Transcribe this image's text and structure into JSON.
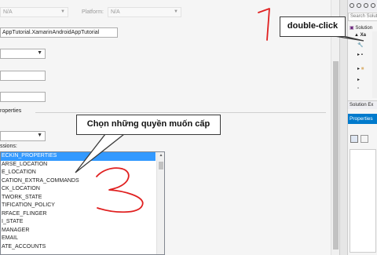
{
  "top_row": {
    "config_value": "N/A",
    "platform_label": "Platform:",
    "platform_value": "N/A"
  },
  "app": {
    "package_name": "AppTutorial.XamarinAndroidAppTutorial"
  },
  "section": {
    "properties_label": "roperties"
  },
  "permissions": {
    "label": "ssions:",
    "items": [
      "ECKIN_PROPERTIES",
      "ARSE_LOCATION",
      "E_LOCATION",
      "CATION_EXTRA_COMMANDS",
      "CK_LOCATION",
      "TWORK_STATE",
      "TIFICATION_POLICY",
      "RFACE_FLINGER",
      "I_STATE",
      "MANAGER",
      "EMAIL",
      "ATE_ACCOUNTS"
    ],
    "selected_index": 0
  },
  "annotations": {
    "callout_main": "Chọn những quyền muốn cấp",
    "callout_dbl": "double-click",
    "step1": "1",
    "step3": "3"
  },
  "solution_explorer": {
    "search_placeholder": "Search Solutio",
    "solution_item": "Solution",
    "project_item": "Xa",
    "tab_label": "Solution Ex",
    "properties_header": "Properties"
  },
  "colors": {
    "selection": "#3399ff",
    "annotation_red": "#e02020",
    "vs_blue": "#007acc"
  }
}
